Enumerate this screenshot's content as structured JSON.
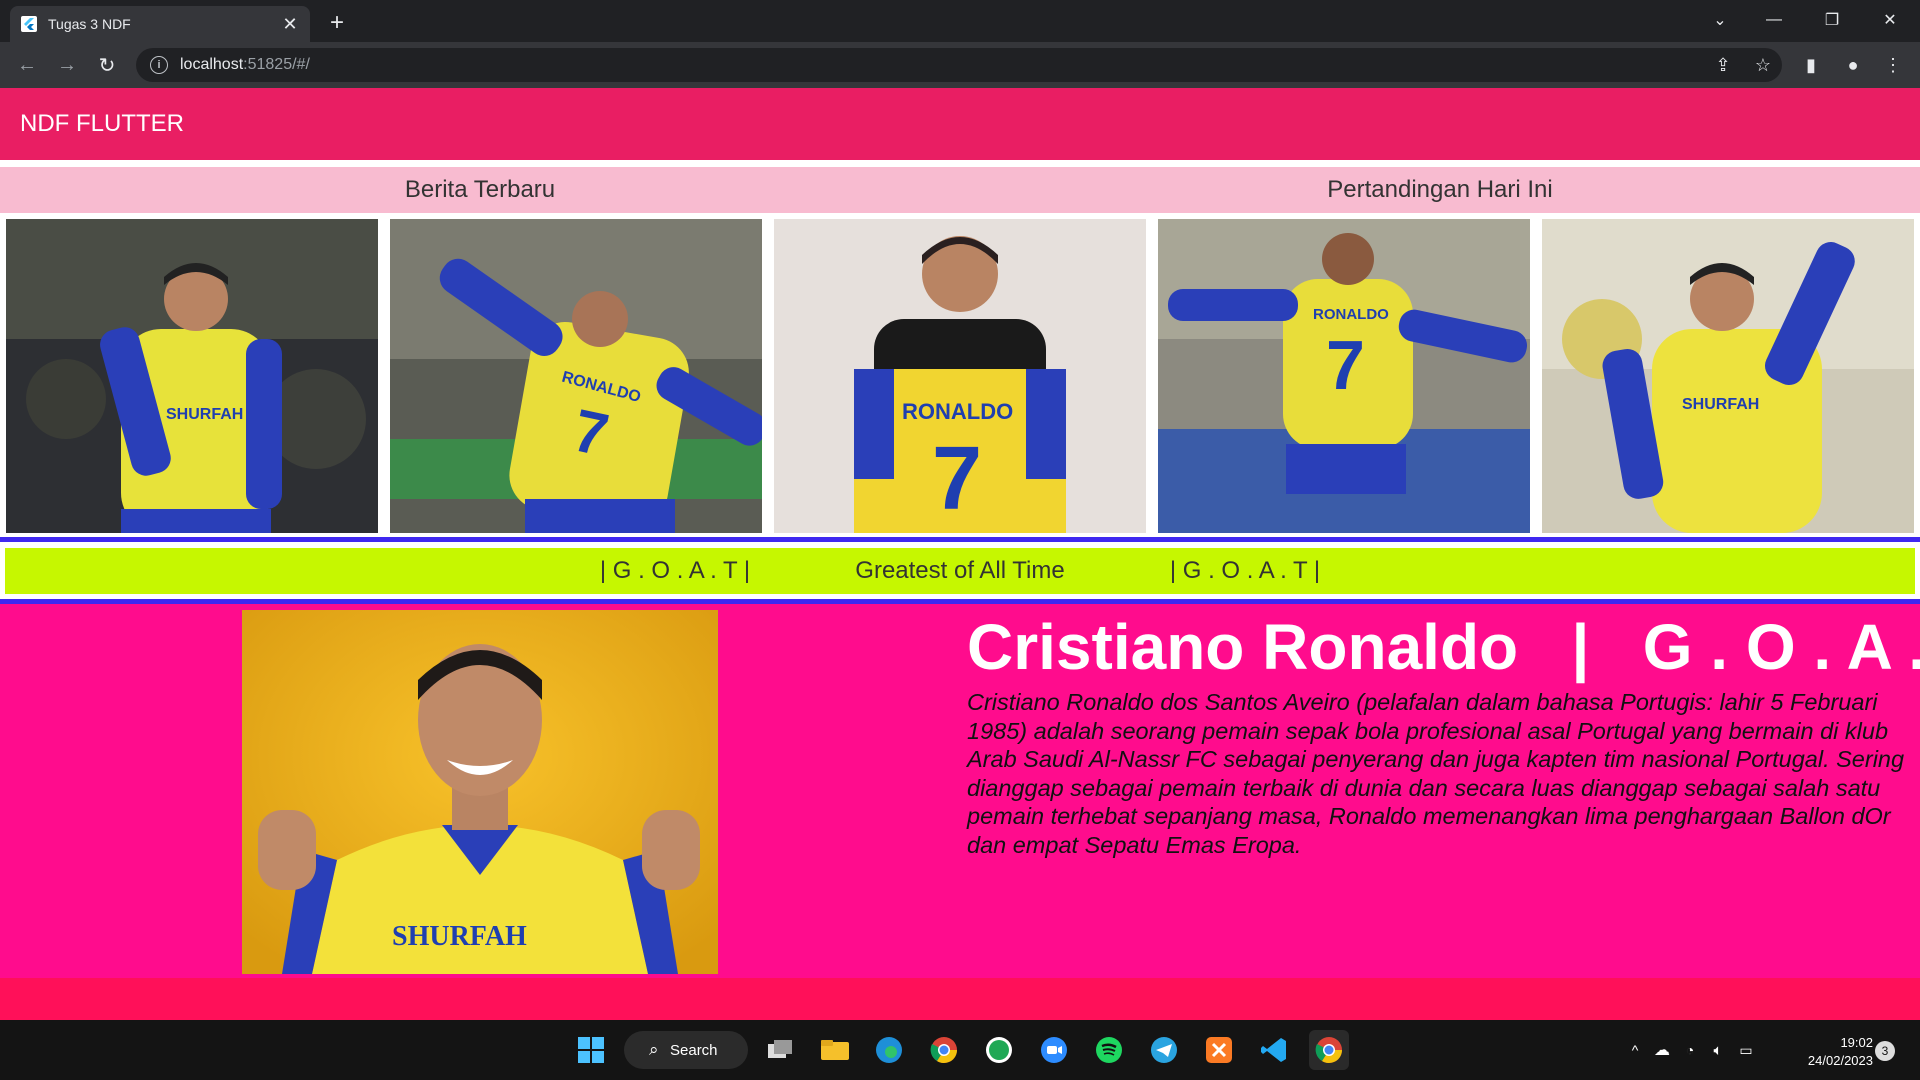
{
  "browser": {
    "tab_title": "Tugas 3 NDF",
    "url_host": "localhost",
    "url_path": ":51825/#/"
  },
  "app": {
    "appbar_title": "NDF FLUTTER",
    "tabs": [
      {
        "label": "Berita Terbaru"
      },
      {
        "label": "Pertandingan Hari Ini"
      }
    ],
    "photos": [
      {
        "name": "ronaldo-photo-1",
        "jersey_text": "SHURFAH"
      },
      {
        "name": "ronaldo-photo-2",
        "jersey_text": "RONALDO"
      },
      {
        "name": "ronaldo-photo-3",
        "jersey_text": "RONALDO"
      },
      {
        "name": "ronaldo-photo-4",
        "jersey_text": "RONALDO"
      },
      {
        "name": "ronaldo-photo-5",
        "jersey_text": "SHURFAH"
      }
    ],
    "banner": {
      "left": "| G . O . A . T |",
      "center": "Greatest of All Time",
      "right": "| G . O . A . T |"
    },
    "profile": {
      "headline": "Cristiano Ronaldo   |   G . O . A . T",
      "bio": "Cristiano Ronaldo dos Santos Aveiro (pelafalan dalam bahasa Portugis: lahir 5 Februari 1985) adalah seorang pemain sepak bola profesional asal Portugal yang bermain di klub Arab Saudi Al-Nassr FC sebagai penyerang dan juga kapten tim nasional Portugal. Sering dianggap sebagai pemain terbaik di dunia dan secara luas dianggap sebagai salah satu pemain terhebat sepanjang masa, Ronaldo memenangkan lima penghargaan Ballon dOr dan empat Sepatu Emas Eropa.",
      "photo_jersey_text": "SHURFAH"
    }
  },
  "taskbar": {
    "search_label": "Search",
    "time": "19:02",
    "date": "24/02/2023",
    "notification_count": "3"
  },
  "colors": {
    "appbar": "#e91e63",
    "tabs_bg": "#f8bbd0",
    "banner": "#c6f700",
    "divider": "#3f28f0",
    "profile_bg": "#ff0c8d",
    "footer": "#ff1059"
  }
}
